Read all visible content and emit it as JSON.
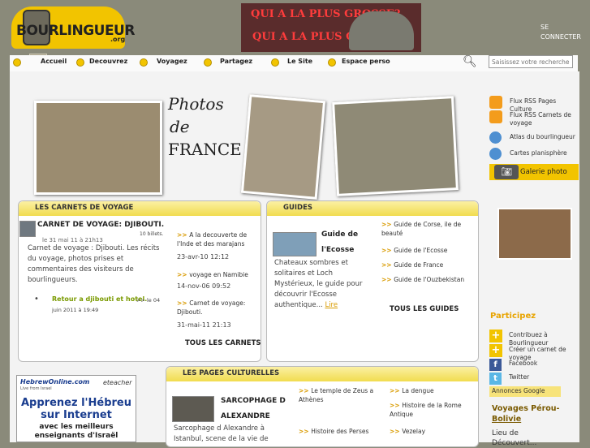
{
  "header": {
    "logo_text": "BOURLINGUEUR",
    "logo_tld": ".org",
    "banner_line1": "QUI A LA PLUS GROSSE?",
    "banner_line2": "QUI A LA PLUS GRANDE?",
    "connect_label": "SE CONNECTER"
  },
  "nav": {
    "items": [
      "Accueil",
      "Decouvrez",
      "Voyagez",
      "Partagez",
      "Le Site",
      "Espace perso"
    ]
  },
  "search": {
    "placeholder": "Saisissez votre recherche ici..."
  },
  "photos": {
    "title_line1": "Photos",
    "title_line2": "de",
    "title_line3": "FRANCE"
  },
  "carnets": {
    "header": "LES CARNETS DE VOYAGE",
    "featured_title": "CARNET DE VOYAGE: DJIBOUTI.",
    "billets": "10 billets.",
    "date": "le 31 mai 11 à 21h13",
    "description": "Carnet de voyage : Djibouti. Les récits du voyage, photos prises et commentaires des visiteurs de bourlingueurs.",
    "bullet_link": "Retour a djibouti et hotel.",
    "bullet_meta": ">> le 04 juin 2011 à 19:49",
    "list": [
      {
        "title": "A la decouverte de l'Inde et des marajans",
        "date": "23-avr-10 12:12"
      },
      {
        "title": "voyage en Namibie",
        "date": "14-nov-06 09:52"
      },
      {
        "title": "Carnet de voyage: Djibouti.",
        "date": "31-mai-11 21:13"
      }
    ],
    "all_label": "TOUS LES CARNETS"
  },
  "guides": {
    "header": "GUIDES",
    "featured_title_line1": "Guide de",
    "featured_title_line2": "l'Ecosse",
    "description": "Chateaux sombres et solitaires et Loch Mystérieux, le guide pour découvrir l'Ecosse authentique...",
    "read_more": "Lire",
    "list": [
      "Guide de Corse, ile de beauté",
      "Guide de l'Ecosse",
      "Guide de France",
      "Guide de l'Ouzbekistan"
    ],
    "all_label": "TOUS LES GUIDES"
  },
  "culture": {
    "header": "LES PAGES CULTURELLES",
    "featured_title_line1": "SARCOPHAGE D",
    "featured_title_line2": "ALEXANDRE",
    "description": "Sarcophage d Alexandre à Istanbul, scene de la vie de",
    "list_left": [
      "Le temple de Zeus a Athènes",
      "Histoire des Perses"
    ],
    "list_right": [
      "La dengue",
      "Histoire de la Rome Antique",
      "Vezelay"
    ]
  },
  "ad_left": {
    "brand": "HebrewOnline.com",
    "tagline": "Live from Israel",
    "partner": "eteacher",
    "headline1": "Apprenez l'Hébreu",
    "headline2": "sur Internet",
    "sub1": "avec les meilleurs",
    "sub2": "enseignants d'Israël"
  },
  "sidebar": {
    "links": [
      "Flux RSS Pages Culture",
      "Flux RSS Carnets de voyage",
      "Atlas du bourlingueur",
      "Cartes planisphère"
    ],
    "gallery_label": "Galerie photo",
    "participez_title": "Participez",
    "participez_items": [
      "Contribuez à Bourlingueur",
      "Créer un carnet de voyage",
      "Facebook",
      "Twitter"
    ],
    "ads_label": "Annonces Google",
    "ad_title_line1": "Voyages Pérou-",
    "ad_title_line2": "Bolivie",
    "ad_text_line1": "Lieu de",
    "ad_text_line2": "Découvert..."
  },
  "colors": {
    "accent": "#f2c400",
    "banner_text": "#ff3c3c",
    "sidebar_title": "#e8a400"
  }
}
